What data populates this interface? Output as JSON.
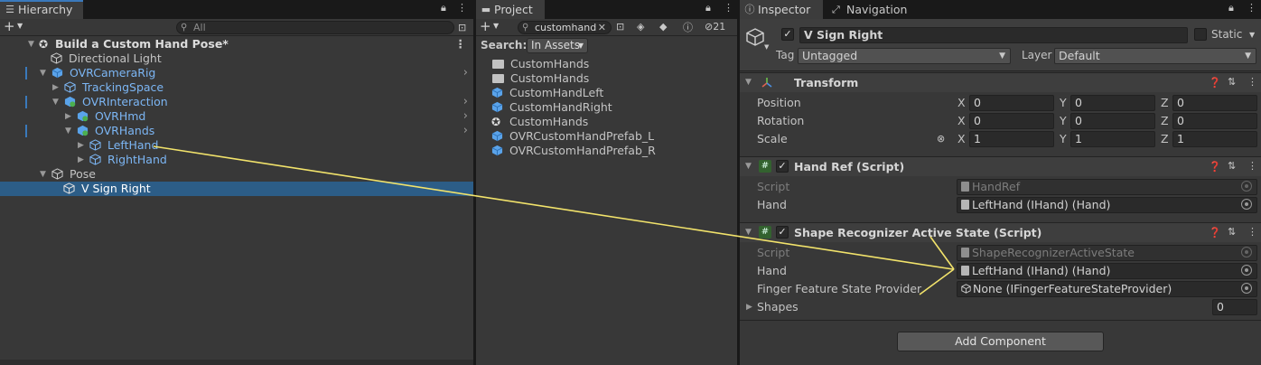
{
  "hierarchy": {
    "tab_label": "Hierarchy",
    "search_placeholder": "All",
    "scene_name": "Build a Custom Hand Pose*",
    "items": [
      {
        "label": "Directional Light"
      },
      {
        "label": "OVRCameraRig"
      },
      {
        "label": "TrackingSpace"
      },
      {
        "label": "OVRInteraction"
      },
      {
        "label": "OVRHmd"
      },
      {
        "label": "OVRHands"
      },
      {
        "label": "LeftHand"
      },
      {
        "label": "RightHand"
      },
      {
        "label": "Pose"
      },
      {
        "label": "V Sign Right"
      }
    ]
  },
  "project": {
    "tab_label": "Project",
    "search_value": "customhand",
    "hidden_count": "21",
    "search_label": "Search:",
    "search_scope": "In Assets",
    "items": [
      {
        "label": "CustomHands"
      },
      {
        "label": "CustomHands"
      },
      {
        "label": "CustomHandLeft"
      },
      {
        "label": "CustomHandRight"
      },
      {
        "label": "CustomHands"
      },
      {
        "label": "OVRCustomHandPrefab_L"
      },
      {
        "label": "OVRCustomHandPrefab_R"
      }
    ]
  },
  "inspector": {
    "tab_label": "Inspector",
    "nav_tab_label": "Navigation",
    "object_name": "V Sign Right",
    "static_label": "Static",
    "tag_label": "Tag",
    "tag_value": "Untagged",
    "layer_label": "Layer",
    "layer_value": "Default",
    "transform": {
      "title": "Transform",
      "position_label": "Position",
      "rotation_label": "Rotation",
      "scale_label": "Scale",
      "x": "X",
      "y": "Y",
      "z": "Z",
      "position": [
        "0",
        "0",
        "0"
      ],
      "rotation": [
        "0",
        "0",
        "0"
      ],
      "scale": [
        "1",
        "1",
        "1"
      ]
    },
    "hand_ref": {
      "title": "Hand Ref (Script)",
      "script_label": "Script",
      "script_value": "HandRef",
      "hand_label": "Hand",
      "hand_value": "LeftHand (IHand) (Hand)"
    },
    "shape_recognizer": {
      "title": "Shape Recognizer Active State (Script)",
      "script_label": "Script",
      "script_value": "ShapeRecognizerActiveState",
      "hand_label": "Hand",
      "hand_value": "LeftHand (IHand) (Hand)",
      "finger_label": "Finger Feature State Provider",
      "finger_value": "None (IFingerFeatureStateProvider)",
      "shapes_label": "Shapes",
      "shapes_value": "0"
    },
    "add_component_label": "Add Component"
  },
  "colors": {
    "selection": "#2c5d87",
    "accent_line": "#3a79bb",
    "prefab_blue": "#7cb6f4",
    "annotation_arrow": "#f2e36b"
  }
}
